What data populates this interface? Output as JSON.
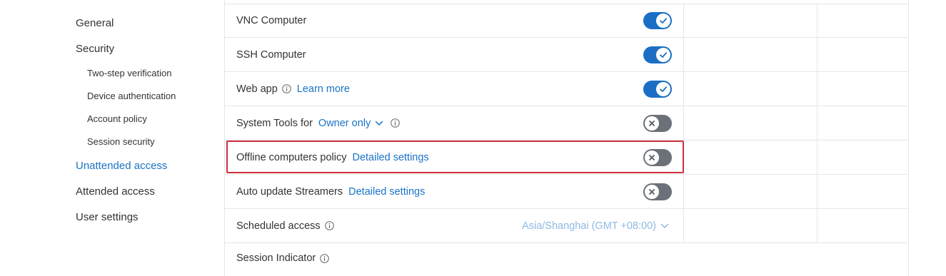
{
  "sidebar": {
    "items": [
      {
        "label": "General"
      },
      {
        "label": "Security"
      },
      {
        "label": "Two-step verification"
      },
      {
        "label": "Device authentication"
      },
      {
        "label": "Account policy"
      },
      {
        "label": "Session security"
      },
      {
        "label": "Unattended access"
      },
      {
        "label": "Attended access"
      },
      {
        "label": "User settings"
      }
    ],
    "active": "Unattended access"
  },
  "rows": {
    "vnc": {
      "label": "VNC Computer",
      "toggle": "on"
    },
    "ssh": {
      "label": "SSH Computer",
      "toggle": "on"
    },
    "webapp": {
      "label": "Web app",
      "link": "Learn more",
      "toggle": "on"
    },
    "systools": {
      "label": "System Tools for",
      "dropdown": "Owner only",
      "toggle": "off"
    },
    "offline": {
      "label": "Offline computers policy",
      "link": "Detailed settings",
      "toggle": "off"
    },
    "autoupdate": {
      "label": "Auto update Streamers",
      "link": "Detailed settings",
      "toggle": "off"
    },
    "scheduled": {
      "label": "Scheduled access",
      "timezone": "Asia/Shanghai (GMT +08:00)"
    },
    "indicator": {
      "label": "Session Indicator"
    }
  },
  "colors": {
    "accent": "#1a73c8",
    "toggle_on": "#1a6fc4",
    "toggle_off": "#6b7079",
    "highlight": "#d0303d",
    "timezone": "#8fb9e3"
  }
}
